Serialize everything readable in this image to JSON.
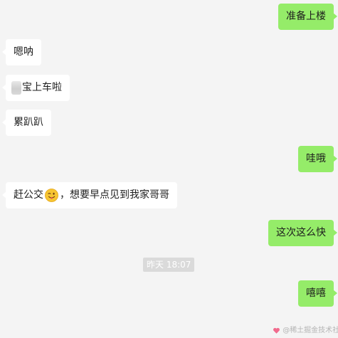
{
  "messages": [
    {
      "from": "me",
      "text": "准备上楼"
    },
    {
      "from": "other",
      "text": "嗯呐"
    },
    {
      "from": "other",
      "text": "宝上车啦"
    },
    {
      "from": "other",
      "text": "累趴趴"
    },
    {
      "from": "me",
      "text": "哇哦"
    },
    {
      "from": "other",
      "text_before": "赶公交",
      "emoji": "winking-face-with-tongue",
      "text_after": "，想要早点见到我家哥哥"
    },
    {
      "from": "me",
      "text": "这次这么快"
    },
    {
      "from": "me",
      "text": "嘻嘻"
    }
  ],
  "timestamp": "昨天 18:07",
  "watermark": "@稀土掘金技术社区",
  "colors": {
    "background": "#f4f4f4",
    "my_bubble": "#95ec69",
    "other_bubble": "#ffffff",
    "timestamp_pill": "#dadada"
  },
  "icons": [
    "sticker-thumbnail",
    "winking-face-with-tongue-emoji",
    "heart-icon"
  ]
}
